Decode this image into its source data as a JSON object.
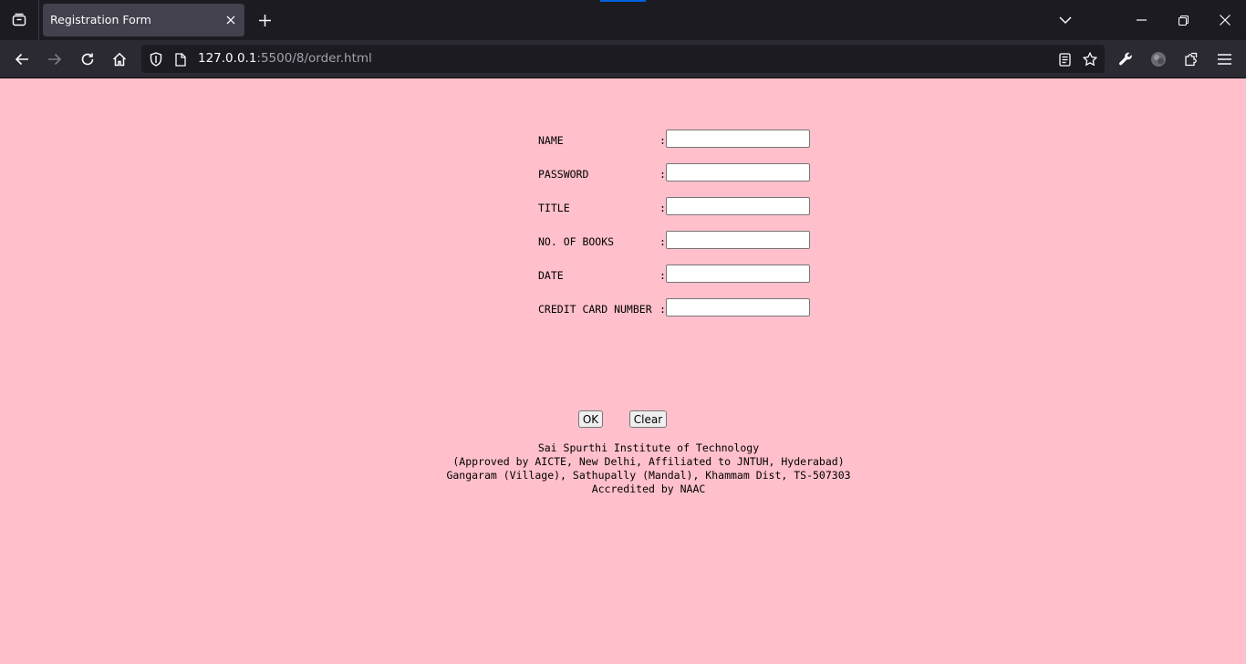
{
  "browser": {
    "tab_title": "Registration Form",
    "url_host": "127.0.0.1",
    "url_rest": ":5500/8/order.html"
  },
  "form": {
    "fields": [
      {
        "label": "NAME",
        "value": ""
      },
      {
        "label": "PASSWORD",
        "value": ""
      },
      {
        "label": "TITLE",
        "value": ""
      },
      {
        "label": "NO. OF BOOKS",
        "value": ""
      },
      {
        "label": "DATE",
        "value": ""
      },
      {
        "label": "CREDIT CARD NUMBER",
        "value": ""
      }
    ],
    "colon": ":",
    "ok_label": "OK",
    "clear_label": "Clear"
  },
  "footer": {
    "line1": "Sai Spurthi Institute of Technology",
    "line2": "(Approved by AICTE, New Delhi, Affiliated to JNTUH, Hyderabad)",
    "line3": "Gangaram (Village), Sathupally (Mandal), Khammam Dist, TS-507303",
    "line4": "Accredited by NAAC"
  },
  "colors": {
    "page_background": "#ffc0cb",
    "chrome_dark": "#1c1b22",
    "toolbar": "#2b2a33"
  }
}
